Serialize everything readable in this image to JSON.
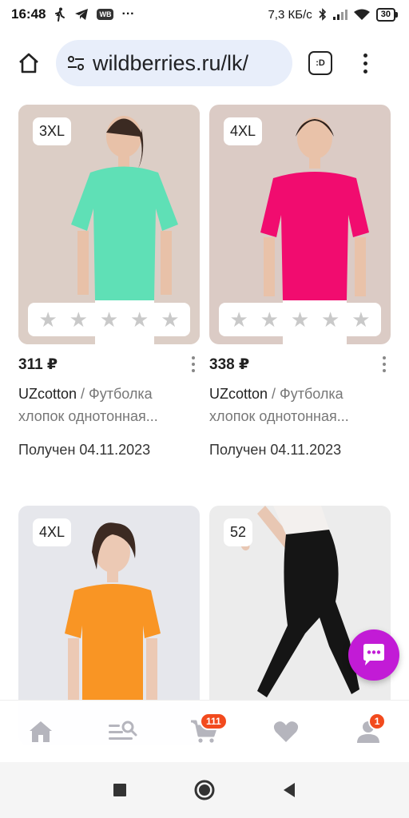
{
  "status_bar": {
    "time": "16:48",
    "wb_badge": "WB",
    "more": "···",
    "network_speed": "7,3 КБ/с",
    "battery": "30"
  },
  "browser": {
    "url": "wildberries.ru/lk/",
    "tabs_label": ":D"
  },
  "products": [
    {
      "size": "3XL",
      "price": "311 ₽",
      "brand": "UZcotton",
      "title_rest": " / Футболка хлопок однотонная...",
      "received": "Получен 04.11.2023",
      "color": "#5fe0b6"
    },
    {
      "size": "4XL",
      "price": "338 ₽",
      "brand": "UZcotton",
      "title_rest": " / Футболка хлопок однотонная...",
      "received": "Получен 04.11.2023",
      "color": "#f10c6f"
    },
    {
      "size": "4XL",
      "color": "#f99524"
    },
    {
      "size": "52",
      "color": "#151515"
    }
  ],
  "bottom_nav": {
    "cart_badge": "111",
    "profile_badge": "1"
  },
  "colors": {
    "accent": "#c21bd6",
    "badge": "#f24a1d",
    "url_bg": "#e8eefa"
  }
}
